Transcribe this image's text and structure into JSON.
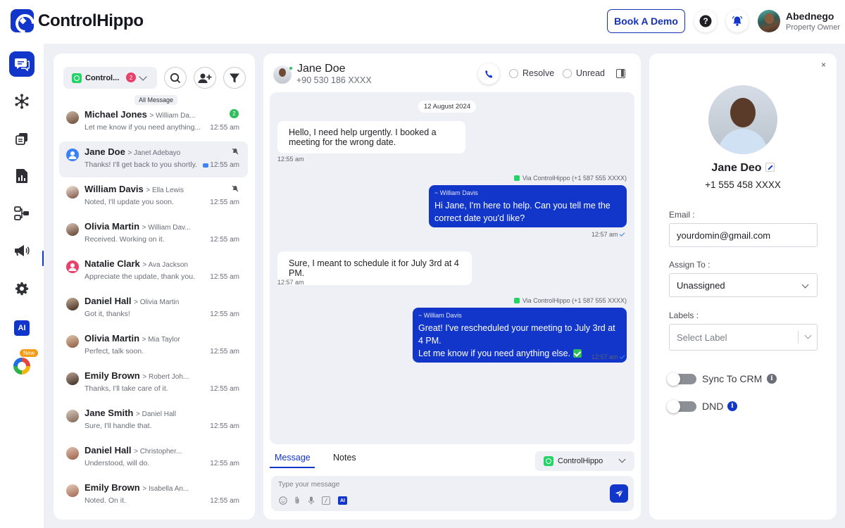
{
  "brand": {
    "name": "ControlHippo"
  },
  "header": {
    "demo_label": "Book A Demo",
    "user_name": "Abednego",
    "user_role": "Property Owner"
  },
  "nav": {
    "items": [
      "chat-icon",
      "network-icon",
      "copy-icon",
      "report-icon",
      "workflow-icon",
      "megaphone-icon",
      "gear-icon",
      "ai-icon",
      "integration-icon"
    ],
    "ai_label": "AI",
    "new_badge": "New"
  },
  "list": {
    "channel_label": "Control...",
    "channel_count": "2",
    "tooltip": "All Message",
    "conversations": [
      {
        "name": "Michael Jones",
        "agent": "> William Da...",
        "message": "Let me know if you need anything...",
        "time": "12:55 am",
        "unread": "2"
      },
      {
        "name": "Jane Doe",
        "agent": "> Janet Adebayo",
        "message": "Thanks! I'll get back to you shortly.",
        "time": "12:55 am"
      },
      {
        "name": "William Davis",
        "agent": "> Ella Lewis",
        "message": "Noted, I'll update you soon.",
        "time": "12:55 am"
      },
      {
        "name": "Olivia Martin",
        "agent": "> William Dav...",
        "message": "Received. Working on it.",
        "time": "12:55 am"
      },
      {
        "name": "Natalie Clark",
        "agent": "> Ava Jackson",
        "message": "Appreciate the update, thank you.",
        "time": "12:55 am"
      },
      {
        "name": "Daniel Hall",
        "agent": "> Olivia Martin",
        "message": "Got it, thanks!",
        "time": "12:55 am"
      },
      {
        "name": "Olivia Martin",
        "agent": "> Mia Taylor",
        "message": "Perfect, talk soon.",
        "time": "12:55 am"
      },
      {
        "name": "Emily Brown",
        "agent": "> Robert Joh...",
        "message": "Thanks, I'll take care of it.",
        "time": "12:55 am"
      },
      {
        "name": "Jane Smith",
        "agent": "> Daniel Hall",
        "message": "Sure, I'll handle that.",
        "time": "12:55 am"
      },
      {
        "name": "Daniel Hall",
        "agent": "> Christopher...",
        "message": "Understood, will do.",
        "time": "12:55 am"
      },
      {
        "name": "Emily Brown",
        "agent": "> Isabella An...",
        "message": "Noted. On it.",
        "time": "12:55 am"
      }
    ]
  },
  "chat": {
    "contact_name": "Jane Doe",
    "contact_phone": "+90 530 186 XXXX",
    "resolve_label": "Resolve",
    "unread_label": "Unread",
    "date_chip": "12 August 2024",
    "messages": [
      {
        "direction": "in",
        "text": "Hello, I need help urgently. I booked a meeting for the wrong date.",
        "time": "12:55 am"
      },
      {
        "direction": "out",
        "via": "Via ControlHippo (+1 587 555 XXXX)",
        "sender": "~ William Davis",
        "text": "Hi Jane, I'm here to help. Can you tell me the correct date you'd like?",
        "time": "12:57 am"
      },
      {
        "direction": "in",
        "text": "Sure, I meant to schedule it for July 3rd at 4 PM.",
        "time": "12:57 am"
      },
      {
        "direction": "out",
        "via": "Via ControlHippo (+1 587 555 XXXX)",
        "sender": "~ William Davis",
        "text_line1": "Great! I've rescheduled your meeting to July 3rd at 4 PM.",
        "text_line2": "Let me know if you need anything else.",
        "time": "12:57 am"
      }
    ],
    "tabs": [
      "Message",
      "Notes"
    ],
    "send_via": "ControlHippo",
    "composer_placeholder": "Type your message",
    "composer_ai": "AI"
  },
  "profile": {
    "name": "Jane Deo",
    "phone": "+1 555 458 XXXX",
    "email_label": "Email :",
    "email_value": "yourdomin@gmail.com",
    "assign_label": "Assign To :",
    "assign_value": "Unassigned",
    "labels_label": "Labels :",
    "labels_placeholder": "Select Label",
    "sync_label": "Sync To CRM",
    "dnd_label": "DND",
    "close_symbol": "×"
  },
  "colors": {
    "accent": "#1236c9",
    "background": "#eef0f6",
    "whatsapp": "#25d366",
    "unread_badge": "#2fbd5c",
    "count_badge": "#e8416a"
  }
}
